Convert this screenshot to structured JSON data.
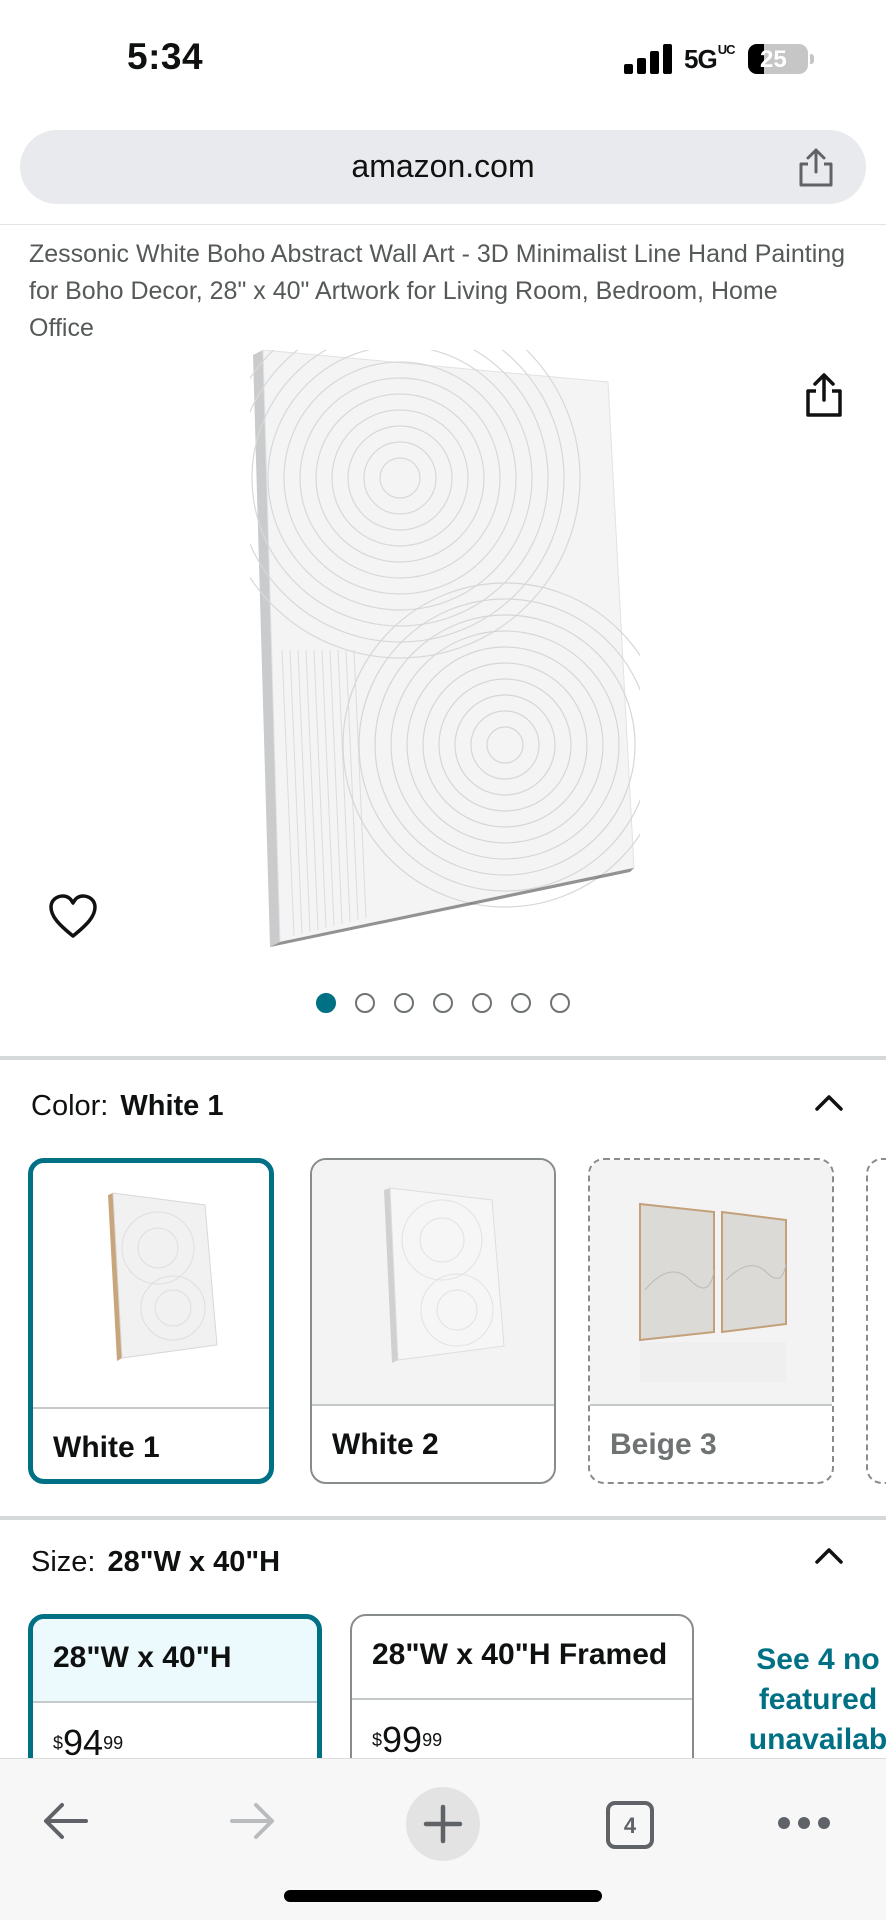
{
  "status_bar": {
    "time": "5:34",
    "network": "5G",
    "network_badge": "UC",
    "battery": "25"
  },
  "browser": {
    "url": "amazon.com",
    "open_tabs": "4"
  },
  "product": {
    "title": "Zessonic White Boho Abstract Wall Art - 3D Minimalist Line Hand Painting for Boho Decor, 28\" x 40\" Artwork for Living Room, Bedroom, Home Office",
    "image_count": 7,
    "active_image": 1
  },
  "color": {
    "label": "Color:",
    "selected": "White 1",
    "options": [
      {
        "label": "White 1",
        "state": "selected"
      },
      {
        "label": "White 2",
        "state": "available"
      },
      {
        "label": "Beige 3",
        "state": "unavailable"
      }
    ]
  },
  "size": {
    "label": "Size:",
    "selected": "28\"W x 40\"H",
    "options": [
      {
        "label": "28\"W x 40\"H",
        "price_whole": "94",
        "price_fraction": "99",
        "currency": "$",
        "state": "selected"
      },
      {
        "label": "28\"W x 40\"H Framed",
        "price_whole": "99",
        "price_fraction": "99",
        "currency": "$",
        "state": "available"
      }
    ],
    "see_more_lines": [
      "See 4 no",
      "featured",
      "unavailab"
    ]
  },
  "colors": {
    "accent": "#007185",
    "selected_bg": "#edfafd",
    "muted_text": "#565959"
  }
}
